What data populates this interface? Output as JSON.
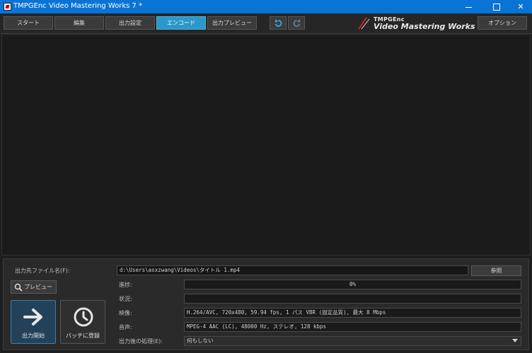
{
  "window": {
    "title": "TMPGEnc Video Mastering Works 7 *"
  },
  "toolbar": {
    "tabs": [
      {
        "label": "スタート"
      },
      {
        "label": "編集"
      },
      {
        "label": "出力設定"
      },
      {
        "label": "エンコード",
        "active": true
      },
      {
        "label": "出力プレビュー"
      }
    ],
    "undo_icon": "undo-icon",
    "redo_icon": "redo-icon",
    "brand_small": "TMPGEnc",
    "brand_big": "Video Mastering Works 7",
    "options_label": "オプション"
  },
  "encode": {
    "output_filename_label": "出力先ファイル名(F):",
    "output_filename_value": "d:\\Users\\asxzwang\\Videos\\タイトル 1.mp4",
    "browse_label": "参照",
    "preview_button_label": "プレビュー",
    "start_button_label": "出力開始",
    "batch_button_label": "バッチに登録",
    "progress_label": "進捗:",
    "progress_text": "0%",
    "progress_value": 0,
    "status_label": "状況:",
    "status_value": "",
    "video_label": "映像:",
    "video_value": "H.264/AVC, 720x480, 59.94 fps, 1 パス VBR (固定品質), 最大 8 Mbps",
    "audio_label": "音声:",
    "audio_value": "MPEG-4 AAC (LC), 48000 Hz, ステレオ, 128 kbps",
    "after_label": "出力後の処理(E):",
    "after_value": "何もしない"
  },
  "colors": {
    "titlebar": "#0a73d6",
    "active_tab": "#2b98c9",
    "background": "#1e1e1e"
  }
}
